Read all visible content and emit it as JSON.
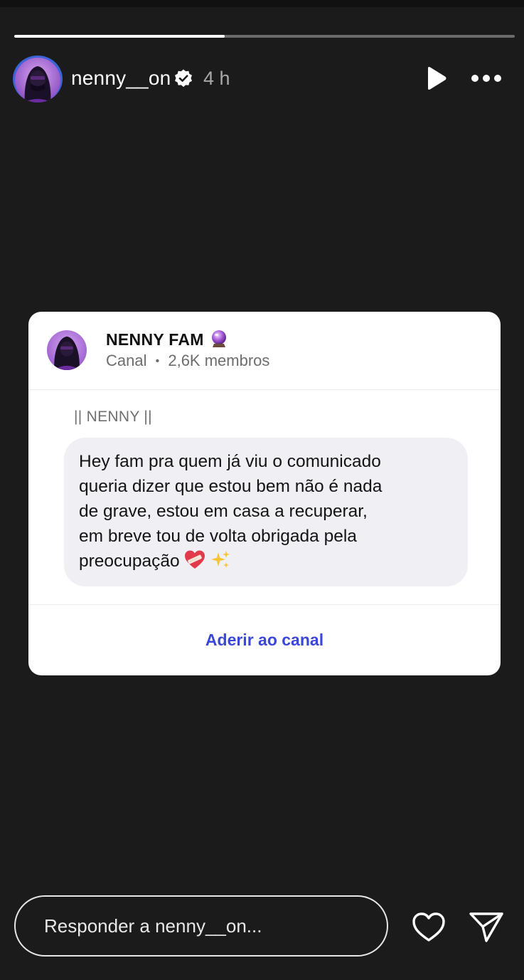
{
  "story": {
    "progress": 0.42,
    "username": "nenny__on",
    "verified": true,
    "time_ago": "4 h"
  },
  "card": {
    "channel_name": "NENNY FAM",
    "channel_emoji": "crystal-ball-icon",
    "channel_type": "Canal",
    "separator": "•",
    "members": "2,6K membros",
    "sender": "|| NENNY ||",
    "message": "Hey fam pra quem já viu o comunicado\nqueria dizer que estou bem não é nada\nde grave, estou em casa a recuperar,\nem breve tou de volta obrigada pela\npreocupação",
    "message_emojis": [
      "mending-heart-icon",
      "sparkles-icon"
    ],
    "join_label": "Aderir ao canal"
  },
  "reply": {
    "placeholder": "Responder a nenny__on..."
  },
  "colors": {
    "background": "#1b1b1b",
    "card": "#ffffff",
    "bubble": "#efeff4",
    "link": "#3b47d8",
    "avatar_ring": "#3d63d6"
  }
}
